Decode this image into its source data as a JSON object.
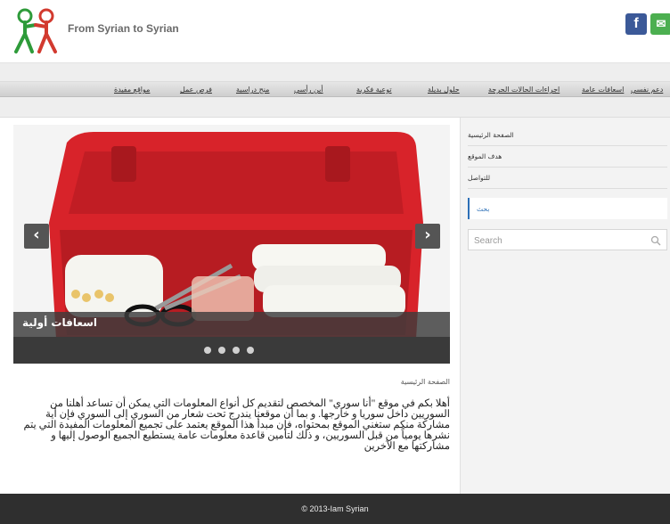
{
  "header": {
    "site_title": "From Syrian to Syrian",
    "social": {
      "facebook_glyph": "f",
      "email_glyph": "✉"
    }
  },
  "nav": {
    "items": [
      "دعم نفسي",
      "اسعافات عامة",
      "اجراءات الحالات الحرجة",
      "حلول بديلة",
      "توعية فكرية",
      "أين رأسي",
      "منح دراسية",
      "فرص عمل",
      "مواقع مفيدة"
    ]
  },
  "slider": {
    "caption": "اسعافات أولية",
    "prev_glyph": "‹",
    "next_glyph": "›",
    "dot_count": 4
  },
  "main": {
    "breadcrumb": "الصفحة الرئيسية",
    "intro": "أهلا بكم في موقع \"أنا سوري\" المخصص لتقديم كل أنواع المعلومات التي يمكن أن تساعد أهلنا من السوريين داخل سوريا و خارجها. و بما أن موقعنا يندرج تحت شعار من السوري إلى السوري فإن أية مشاركة منكم ستغني الموقع بمحتواه، فإن مبدأ هذا الموقع يعتمد على تجميع المعلومات المفيدة التي يتم نشرها يومياً من قبل السوريين، و ذلك لتأمين قاعدة معلومات عامة يستطيع الجميع الوصول إليها و مشاركتها مع الآخرين"
  },
  "sidebar": {
    "links": [
      "الصفحة الرئيسية",
      "هدف الموقع",
      "للتواصل"
    ],
    "search_tab": "بحث",
    "search_placeholder": "Search"
  },
  "footer": {
    "copyright": "© 2013-Iam Syrian"
  },
  "colors": {
    "accent": "#2c6fb7",
    "footer_bg": "#2f2f2f",
    "facebook": "#3b5998",
    "email": "#4caf50",
    "logo_green": "#2e9b3a",
    "logo_red": "#d23a2f"
  }
}
